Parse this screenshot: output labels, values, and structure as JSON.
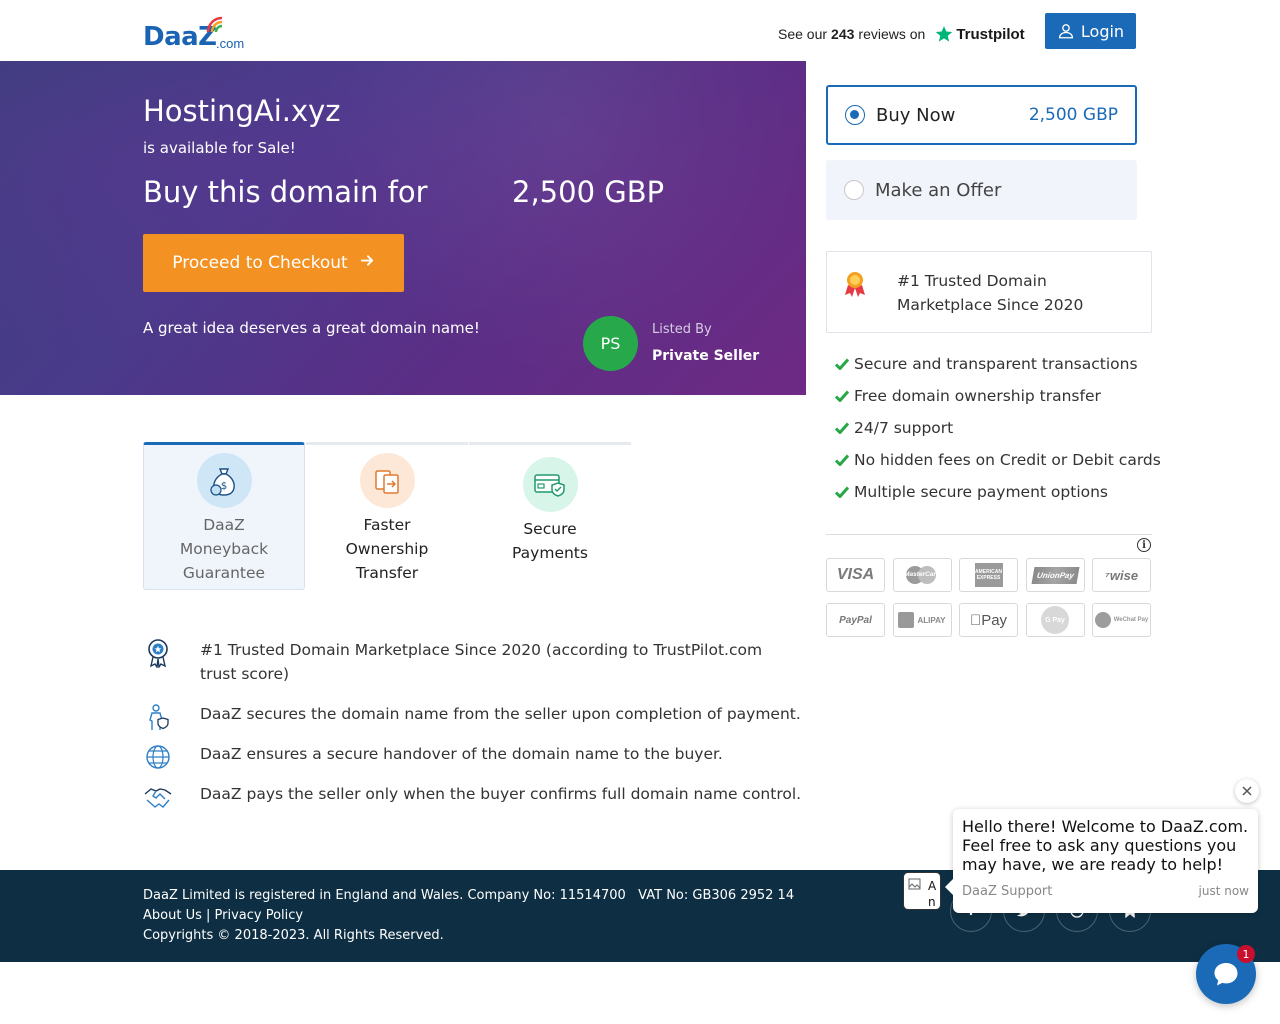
{
  "header": {
    "logo_text": "DaaZ",
    "logo_suffix": ".com",
    "reviews_prefix": "See our",
    "reviews_count": "243",
    "reviews_suffix": "reviews on",
    "trustpilot_label": "Trustpilot",
    "login_label": "Login"
  },
  "hero": {
    "domain_name": "HostingAi.xyz",
    "availability": "is available for Sale!",
    "buy_label": "Buy this domain for",
    "price": "2,500 GBP",
    "checkout_label": "Proceed to Checkout",
    "tagline": "A great idea deserves a great domain name!",
    "seller_initials": "PS",
    "listed_by_label": "Listed By",
    "seller_name": "Private Seller"
  },
  "purchase_options": {
    "buy_now": {
      "label": "Buy Now",
      "value": "2,500 GBP",
      "selected": true
    },
    "make_offer": {
      "label": "Make an Offer",
      "selected": false
    }
  },
  "trusted_box": {
    "text": "#1 Trusted Domain Marketplace Since 2020"
  },
  "benefits": [
    "Secure and transparent transactions",
    "Free domain ownership transfer",
    "24/7 support",
    "No hidden fees on Credit or Debit cards",
    "Multiple secure payment options"
  ],
  "payment_methods": [
    "VISA",
    "MasterCard",
    "American Express",
    "UnionPay",
    "Wise",
    "PayPal",
    "Alipay",
    "Apple Pay",
    "G Pay",
    "WeChat Pay"
  ],
  "payment_labels": {
    "visa": "VISA",
    "mastercard": "MasterCard",
    "amex": "AMERICAN EXPRESS",
    "unionpay": "UnionPay",
    "wise": "wise",
    "paypal": "PayPal",
    "alipay": "ALIPAY",
    "applepay": "Pay",
    "gpay": "G Pay",
    "wechat": "WeChat Pay"
  },
  "feature_tabs": [
    {
      "label_lines": [
        "DaaZ",
        "Moneyback",
        "Guarantee"
      ],
      "icon": "money-bag-icon",
      "active": true
    },
    {
      "label_lines": [
        "Faster",
        "Ownership",
        "Transfer"
      ],
      "icon": "document-transfer-icon",
      "active": false
    },
    {
      "label_lines": [
        "Secure",
        "Payments"
      ],
      "icon": "secure-card-icon",
      "active": false
    }
  ],
  "info_list": [
    {
      "icon": "award-badge-icon",
      "text": "#1 Trusted Domain Marketplace Since 2020 (according to TrustPilot.com trust score)"
    },
    {
      "icon": "secure-person-icon",
      "text": "DaaZ secures the domain name from the seller upon completion of payment."
    },
    {
      "icon": "globe-icon",
      "text": "DaaZ ensures a secure handover of the domain name to the buyer."
    },
    {
      "icon": "handshake-icon",
      "text": "DaaZ pays the seller only when the buyer confirms full domain name control."
    }
  ],
  "footer": {
    "registration": "DaaZ Limited is registered in England and Wales. Company No: 11514700   VAT No: GB306 2952 14",
    "about_link": "About Us",
    "separator": "|",
    "privacy_link": "Privacy Policy",
    "copyright": "Copyrights © 2018-2023. All Rights Reserved."
  },
  "chat": {
    "message": "Hello there! Welcome to DaaZ.com. Feel free to ask any questions you may have, we are ready to help!",
    "agent": "DaaZ Support",
    "time": "just now",
    "avatar_line1": "A",
    "avatar_line2": "n",
    "unread_count": "1"
  },
  "colors": {
    "brand_blue": "#1a6ab8",
    "checkout_orange": "#f39223",
    "seller_green": "#27a84a",
    "footer_navy": "#0e2f43",
    "check_green": "#28a745"
  }
}
